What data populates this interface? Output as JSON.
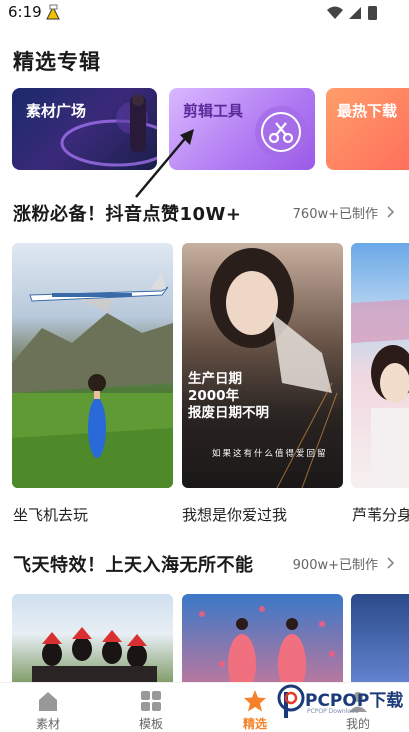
{
  "status_bar": {
    "time": "6:19"
  },
  "page_title": "精选专辑",
  "album_cards": [
    {
      "label": "素材广场"
    },
    {
      "label": "剪辑工具"
    },
    {
      "label": "最热下载"
    }
  ],
  "sections": [
    {
      "title": "涨粉必备！抖音点赞10W+",
      "count": "760w+已制作",
      "items": [
        {
          "caption": "坐飞机去玩"
        },
        {
          "caption": "我想是你爱过我",
          "overlay": [
            "生产日期",
            "2000年",
            "报废日期不明"
          ],
          "subtitle": "如果这有什么值得爱回留"
        },
        {
          "caption": "芦苇分身"
        }
      ]
    },
    {
      "title": "飞天特效！上天入海无所不能",
      "count": "900w+已制作"
    }
  ],
  "nav": [
    {
      "label": "素材",
      "active": false
    },
    {
      "label": "模板",
      "active": false
    },
    {
      "label": "精选",
      "active": true
    },
    {
      "label": "我的",
      "active": false
    }
  ],
  "watermark": {
    "text": "PCPOP下载",
    "sub": "PCPOP Download"
  },
  "colors": {
    "accent": "#f5822a",
    "text": "#1a1a1a",
    "muted": "#666666"
  }
}
